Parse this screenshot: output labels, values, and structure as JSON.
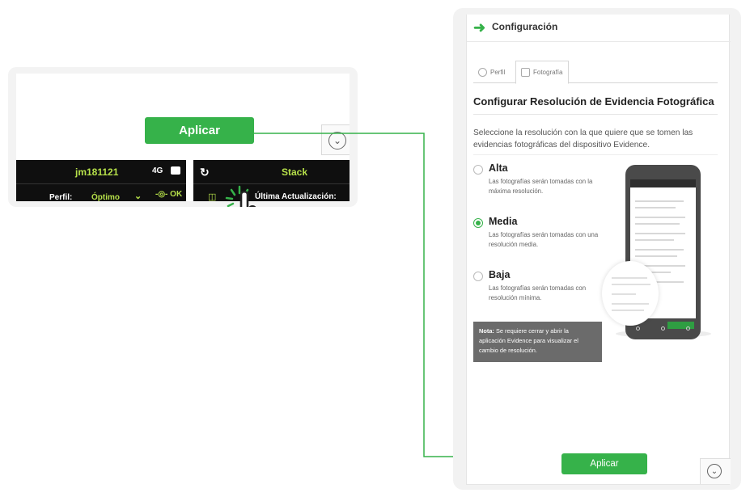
{
  "zoom": {
    "apply_label": "Aplicar",
    "device_name": "jm181121",
    "network": "4G",
    "perfil_label": "Perfil:",
    "perfil_value": "Óptimo",
    "status": "OK",
    "stack_label": "Stack",
    "last_update_label": "Última Actualización:"
  },
  "panel": {
    "title": "Configuración",
    "tabs": [
      {
        "label": "Perfil",
        "icon": "gear-icon"
      },
      {
        "label": "Fotografía",
        "icon": "camera-icon"
      }
    ],
    "section_title": "Configurar Resolución de Evidencia Fotográfica",
    "description": "Seleccione la resolución con la que quiere que se tomen las evidencias fotográficas del dispositivo Evidence.",
    "options": [
      {
        "label": "Alta",
        "description": "Las fotografías serán tomadas con la máxima resolución.",
        "selected": false
      },
      {
        "label": "Media",
        "description": "Las fotografías serán tomadas con una resolución media.",
        "selected": true
      },
      {
        "label": "Baja",
        "description": "Las fotografías serán tomadas con resolución mínima.",
        "selected": false
      }
    ],
    "note_bold": "Nota:",
    "note_text": " Se requiere cerrar y abrir la aplicación Evidence para visualizar el cambio de resolución.",
    "apply_label": "Aplicar"
  },
  "colors": {
    "accent": "#36b24a",
    "lime": "#b6e04a",
    "dark": "#0f0f0f"
  }
}
